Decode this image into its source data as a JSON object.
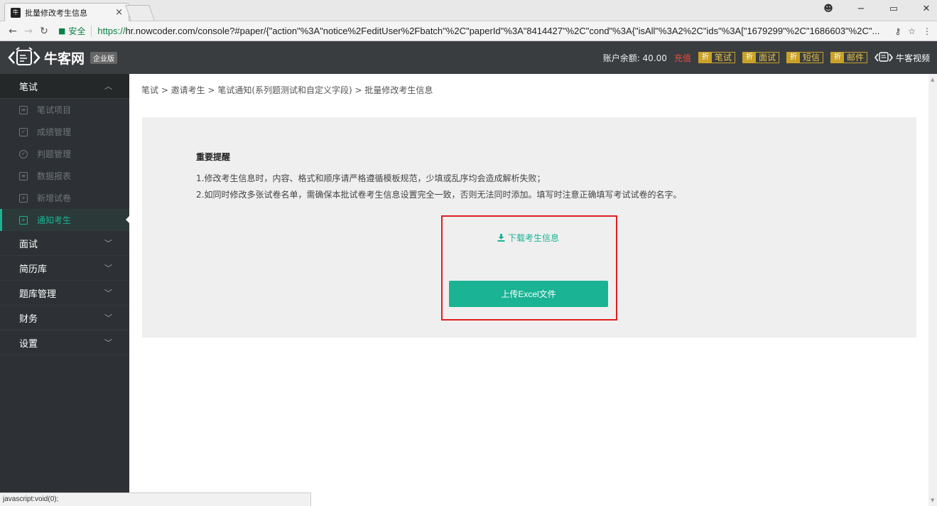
{
  "browser": {
    "tab_title": "批量修改考生信息",
    "tab_favicon": "牛",
    "tab_close": "×",
    "secure_label": "安全",
    "url_proto": "https://",
    "url_rest": "hr.nowcoder.com/console?#paper/{\"action\"%3A\"notice%2FeditUser%2Fbatch\"%2C\"paperId\"%3A\"8414427\"%2C\"cond\"%3A{\"isAll\"%3A2%2C\"ids\"%3A[\"1679299\"%2C\"1686603\"%2C\"...",
    "status_text": "javascript:void(0);"
  },
  "header": {
    "logo_text": "牛客网",
    "logo_badge": "企业版",
    "balance": "账户余额: 40.00",
    "recharge": "充值",
    "zhe": "折",
    "services": [
      "笔试",
      "面试",
      "短信",
      "邮件"
    ],
    "video": "牛客视频"
  },
  "sidebar": {
    "groups": [
      "笔试",
      "面试",
      "简历库",
      "题库管理",
      "财务",
      "设置"
    ],
    "items": [
      "笔试项目",
      "成绩管理",
      "判题管理",
      "数据报表",
      "新增试卷",
      "通知考生"
    ]
  },
  "main": {
    "breadcrumb": "笔试 > 邀请考生 > 笔试通知(系列题测试和自定义字段) > 批量修改考生信息",
    "reminder_title": "重要提醒",
    "reminder_1": "1.修改考生信息时，内容、格式和顺序请严格遵循模板规范，少填或乱序均会造成解析失败；",
    "reminder_2": "2.如同时修改多张试卷名单，需确保本批试卷考生信息设置完全一致，否则无法同时添加。填写时注意正确填写考试试卷的名字。",
    "download_label": "下载考生信息",
    "upload_label": "上传Excel文件"
  },
  "colors": {
    "accent": "#1ab394",
    "header_bg": "#3a3d40",
    "sidebar_bg": "#2d3135",
    "highlight_box": "#e02020"
  }
}
